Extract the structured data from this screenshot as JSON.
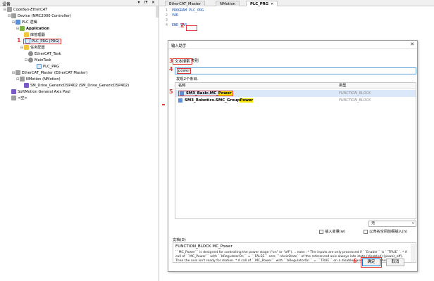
{
  "left_panel": {
    "title": "设备",
    "controls": "▾ ⊓ ✕",
    "tree": [
      {
        "label": "CodeSys-EtherCAT",
        "expander": "⊟"
      },
      {
        "label": "Device (NMC2000 Controller)",
        "expander": "⊟"
      },
      {
        "label": "PLC 逻辑",
        "expander": "⊟"
      },
      {
        "label": "Application",
        "expander": "⊟"
      },
      {
        "label": "库管理器",
        "expander": ""
      },
      {
        "label": "PLC_PRG (PRG)",
        "expander": ""
      },
      {
        "label": "任务配置",
        "expander": "⊟"
      },
      {
        "label": "EtherCAT_Task",
        "expander": ""
      },
      {
        "label": "MainTask",
        "expander": "⊟"
      },
      {
        "label": "PLC_PRG",
        "expander": ""
      },
      {
        "label": "EtherCAT_Master (EtherCAT Master)",
        "expander": "⊟"
      },
      {
        "label": "NMotion (NMotion)",
        "expander": "⊟"
      },
      {
        "label": "SM_Drive_GenericDSP402 (SM_Drive_GenericDSP402)",
        "expander": ""
      },
      {
        "label": "SoftMotion General Axis Pool",
        "expander": ""
      },
      {
        "label": "<空>",
        "expander": ""
      }
    ]
  },
  "tabs": [
    {
      "label": "EtherCAT_Master"
    },
    {
      "label": "NMotion"
    },
    {
      "label": "PLC_PRG",
      "close": "✕"
    }
  ],
  "code": [
    {
      "ln": "1",
      "text": "PROGRAM PLC_PRG"
    },
    {
      "ln": "2",
      "text": "VAR"
    },
    {
      "ln": "3",
      "text": ""
    },
    {
      "ln": "4",
      "text": "END_VAR"
    }
  ],
  "dialog": {
    "title": "输入助手",
    "close": "✕",
    "tab_text_search": "文本搜索",
    "tab_categories": "类别",
    "search_value": "power",
    "found_text": "发现2个条目.",
    "col_name": "名称",
    "col_type": "类型",
    "results": [
      {
        "name_prefix": "SM3_Basic.MC_",
        "name_match": "Power",
        "type": "FUNCTION_BLOCK"
      },
      {
        "name_prefix": "SM3_Robotics.SMC_Group",
        "name_match": "Power",
        "type": "FUNCTION_BLOCK"
      }
    ],
    "dropdown_value": "无",
    "dropdown_arrow": "∨",
    "check_insert_arguments": "插入变量(w)",
    "check_insert_namespace": "以命名空间前缀插入(n)",
    "doc_label": "文档(D)",
    "doc_title": "FUNCTION_BLOCK MC_Power",
    "doc_body": "``MC_Power`` is designed for controlling the power stage (\"on\" or \"off\"). .. note:: * The inputs are only processed if ``Enable`` is ``TRUE``. * A call of ``MC_Power`` with ``bRegulatorOn`` = ``FALSE`` sets ``nAxisState`` of the referenced axis always into state (disabled) (power_off). Then the axis isn't ready for motion. * A call of ``MC_Power`` with ``bRegulatorOn`` = ``TRUE`` on a disabled axis sets its ``nAxisState`` to (standstill) if there is no error on the axis. If an error is detected, the state of the axis is set to ``errorstop``. * If the inputs ``Enable``, ``bRegulatorOn`` and ``bDriveStart`` are ``TRUE`` but the output ``Status`` remains ``FALSE`` for a long time, a possible reason is a hardware problem with the power stage of the drive. * If power fails (also during operation), ``nAxisState`` of the referenced axis is set to (errorstop).",
    "ok_label": "确定",
    "cancel_label": "取消"
  },
  "steps": [
    "1",
    "2",
    "3",
    "4",
    "5",
    "6"
  ]
}
